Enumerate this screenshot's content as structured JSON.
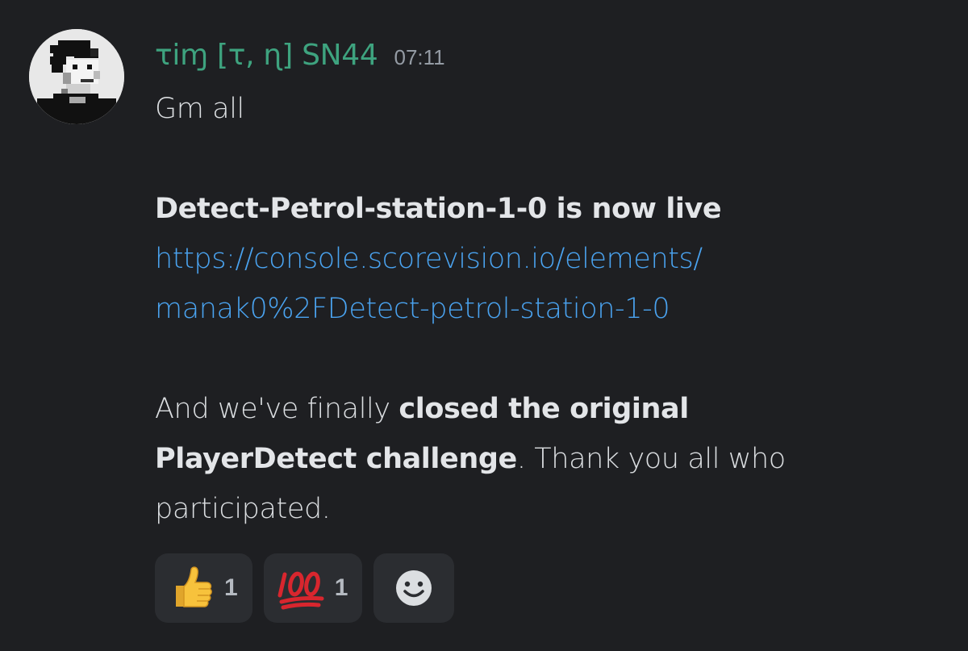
{
  "message": {
    "author": "τiɱ [τ, ɳ] SN44",
    "timestamp": "07:11",
    "colors": {
      "background": "#1e1f22",
      "username": "#3ea37f",
      "link": "#4aa3f0",
      "text": "#dbdee1",
      "reaction_bg": "#2b2d31"
    },
    "lines": {
      "greeting": "Gm all",
      "announcement": "Detect-Petrol-station-1-0 is now live",
      "link_part1": "https://console.scorevision.io/elements/",
      "link_part2": "manak0%2FDetect-petrol-station-1-0",
      "closing_prefix": "And we've finally ",
      "closing_bold1": "closed the original",
      "closing_bold2": "PlayerDetect challenge",
      "closing_suffix": ". Thank you all who",
      "closing_end": "participated."
    }
  },
  "reactions": [
    {
      "emoji_name": "thumbs-up-icon",
      "count": "1"
    },
    {
      "emoji_name": "hundred-points-icon",
      "count": "1"
    }
  ],
  "add_reaction": {
    "icon": "smiley-add-reaction-icon"
  }
}
